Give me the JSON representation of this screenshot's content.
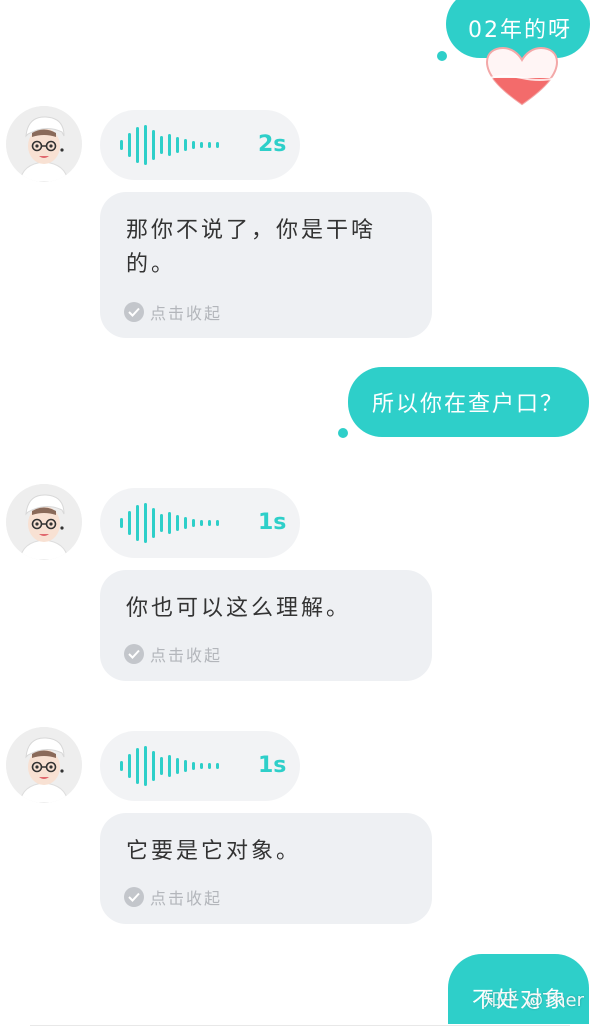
{
  "messages": {
    "out1": {
      "text": "02年的呀"
    },
    "in1": {
      "duration": "2s",
      "text": "那你不说了，你是干啥的。",
      "collapse": "点击收起"
    },
    "out2": {
      "text": "所以你在查户口？"
    },
    "in2": {
      "duration": "1s",
      "text": "你也可以这么理解。",
      "collapse": "点击收起"
    },
    "in3": {
      "duration": "1s",
      "text": "它要是它对象。",
      "collapse": "点击收起"
    },
    "out3": {
      "text": "不处对象"
    }
  },
  "watermark": "知乎 @Ther",
  "colors": {
    "accent": "#2ecfc9",
    "card": "#eef0f3",
    "voice_bubble": "#f2f3f5",
    "muted": "#b3b6bb",
    "heart": "#f36b6b"
  },
  "icons": [
    "heart-sticker-icon",
    "voice-wave-icon",
    "check-circle-icon",
    "avatar"
  ]
}
